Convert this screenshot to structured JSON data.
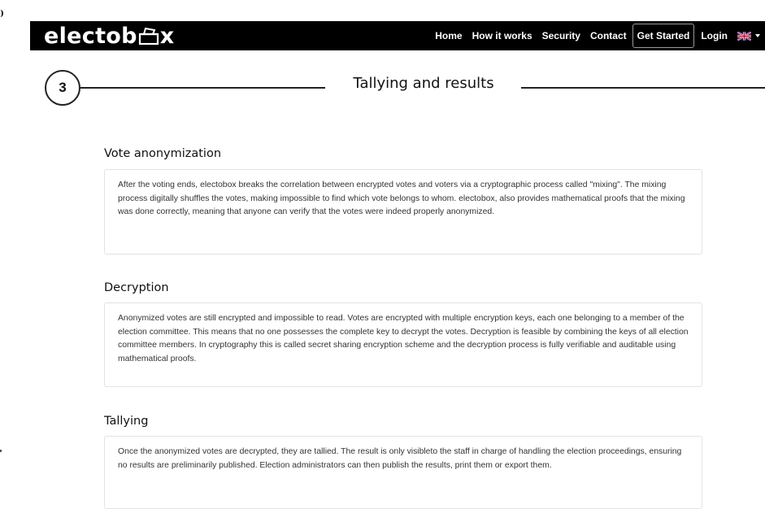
{
  "navbar": {
    "logo_prefix": "electob",
    "logo_suffix": "x",
    "logo_icon": "ballot-box-icon",
    "links": [
      "Home",
      "How it works",
      "Security",
      "Contact"
    ],
    "cta": "Get Started",
    "login": "Login",
    "language_icon": "uk-flag-icon"
  },
  "section": {
    "step": "3",
    "title": "Tallying and results"
  },
  "blocks": [
    {
      "heading": "Vote anonymization",
      "body": "After the voting ends, electobox breaks the correlation between encrypted votes and voters via a cryptographic process called \"mixing\". The mixing process digitally shuffles the votes, making impossible to find which vote belongs to whom. electobox, also provides mathematical proofs that the mixing was done correctly, meaning that anyone can verify that the votes were indeed properly anonymized."
    },
    {
      "heading": "Decryption",
      "body": "Anonymized votes are still encrypted and impossible to read. Votes are encrypted with multiple encryption keys, each one belonging to a member of the election committee. This means that no one possesses the complete key to decrypt the votes. Decryption is feasible by combining the keys of all election committee members. In cryptography this is called secret sharing encryption scheme and the decryption process is fully verifiable and auditable using mathematical proofs."
    },
    {
      "heading": "Tallying",
      "body": "Once the anonymized votes are decrypted, they are tallied. The result is only visibleto the staff in charge of handling the election proceedings, ensuring no results are preliminarily published. Election administrators can then publish the results, print them or export them."
    }
  ]
}
